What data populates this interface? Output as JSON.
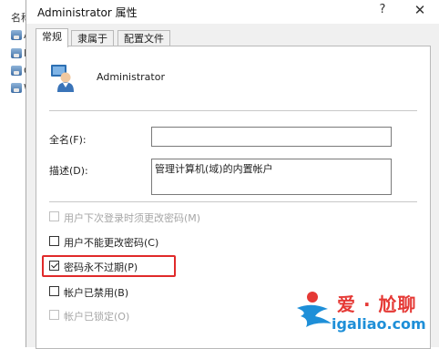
{
  "background": {
    "column_header": "名称",
    "rows": [
      "A",
      "D",
      "G",
      "W"
    ]
  },
  "dialog": {
    "title": "Administrator 属性",
    "help_glyph": "?",
    "close_glyph": "✕",
    "tabs": [
      {
        "label": "常规",
        "active": true
      },
      {
        "label": "隶属于",
        "active": false
      },
      {
        "label": "配置文件",
        "active": false
      }
    ],
    "user": {
      "name": "Administrator",
      "icon": "user-icon"
    },
    "fields": {
      "full_name_label": "全名(F):",
      "full_name_value": "",
      "description_label": "描述(D):",
      "description_value": "管理计算机(域)的内置帐户"
    },
    "checkboxes": [
      {
        "label": "用户下次登录时须更改密码(M)",
        "checked": false,
        "disabled": true
      },
      {
        "label": "用户不能更改密码(C)",
        "checked": false,
        "disabled": false
      },
      {
        "label": "密码永不过期(P)",
        "checked": true,
        "disabled": false
      },
      {
        "label": "帐户已禁用(B)",
        "checked": false,
        "disabled": false
      },
      {
        "label": "帐户已锁定(O)",
        "checked": false,
        "disabled": true
      }
    ],
    "highlight_color": "#e02a2a"
  },
  "watermark": {
    "text_cn": "爱 · 尬聊",
    "url": "igaliao.com"
  }
}
